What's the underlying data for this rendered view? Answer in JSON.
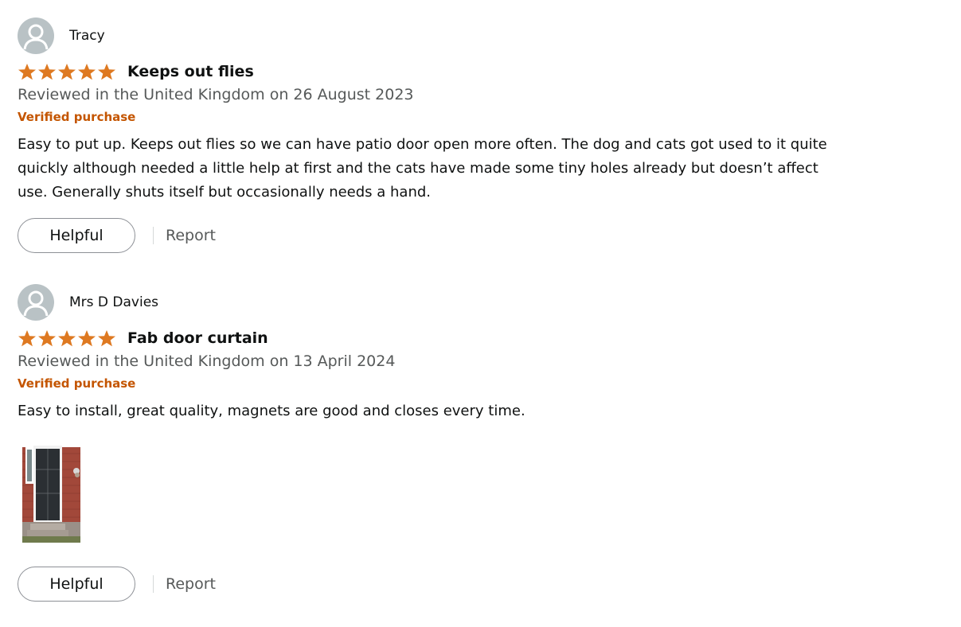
{
  "reviews": [
    {
      "author": "Tracy",
      "rating": 5,
      "rating_max": 5,
      "title": "Keeps out flies",
      "date": "Reviewed in the United Kingdom on 26 August 2023",
      "verified": "Verified purchase",
      "body": "Easy to put up. Keeps out flies so we can have patio door open more often. The dog and cats got used to it quite quickly although needed a little help at first and the cats have made some tiny holes already but doesn’t affect use. Generally shuts itself but occasionally needs a hand.",
      "helpful_label": "Helpful",
      "report_label": "Report"
    },
    {
      "author": "Mrs D Davies",
      "rating": 5,
      "rating_max": 5,
      "title": "Fab door curtain",
      "date": "Reviewed in the United Kingdom on 13 April 2024",
      "verified": "Verified purchase",
      "body": "Easy to install, great quality, magnets are good and closes every time.",
      "has_photo": true,
      "helpful_label": "Helpful",
      "report_label": "Report"
    }
  ],
  "colors": {
    "star": "#de7921",
    "verified": "#c45500",
    "muted_text": "#565959",
    "avatar_bg": "#b9c2c5"
  }
}
